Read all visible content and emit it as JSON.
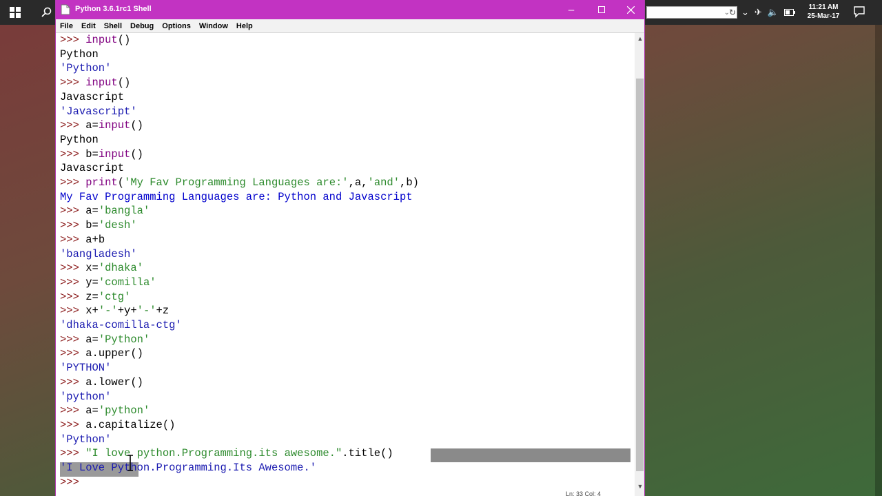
{
  "window": {
    "title": "Python 3.6.1rc1 Shell",
    "menu": [
      "File",
      "Edit",
      "Shell",
      "Debug",
      "Options",
      "Window",
      "Help"
    ]
  },
  "taskbar": {
    "time": "11:21 AM",
    "date": "25-Mar-17"
  },
  "status": {
    "text": "Ln: 33  Col: 4"
  },
  "shell_lines": [
    [
      {
        "t": ">>> ",
        "c": "prompt"
      },
      {
        "t": "input",
        "c": "kw"
      },
      {
        "t": "()",
        "c": "stdin"
      }
    ],
    [
      {
        "t": "Python",
        "c": "stdin"
      }
    ],
    [
      {
        "t": "'Python'",
        "c": "out"
      }
    ],
    [
      {
        "t": ">>> ",
        "c": "prompt"
      },
      {
        "t": "input",
        "c": "kw"
      },
      {
        "t": "()",
        "c": "stdin"
      }
    ],
    [
      {
        "t": "Javascript",
        "c": "stdin"
      }
    ],
    [
      {
        "t": "'Javascript'",
        "c": "out"
      }
    ],
    [
      {
        "t": ">>> ",
        "c": "prompt"
      },
      {
        "t": "a=",
        "c": "stdin"
      },
      {
        "t": "input",
        "c": "kw"
      },
      {
        "t": "()",
        "c": "stdin"
      }
    ],
    [
      {
        "t": "Python",
        "c": "stdin"
      }
    ],
    [
      {
        "t": ">>> ",
        "c": "prompt"
      },
      {
        "t": "b=",
        "c": "stdin"
      },
      {
        "t": "input",
        "c": "kw"
      },
      {
        "t": "()",
        "c": "stdin"
      }
    ],
    [
      {
        "t": "Javascript",
        "c": "stdin"
      }
    ],
    [
      {
        "t": ">>> ",
        "c": "prompt"
      },
      {
        "t": "print",
        "c": "kw"
      },
      {
        "t": "(",
        "c": "stdin"
      },
      {
        "t": "'My Fav Programming Languages are:'",
        "c": "str"
      },
      {
        "t": ",a,",
        "c": "stdin"
      },
      {
        "t": "'and'",
        "c": "str"
      },
      {
        "t": ",b)",
        "c": "stdin"
      }
    ],
    [
      {
        "t": "My Fav Programming Languages are: Python and Javascript",
        "c": "stdout"
      }
    ],
    [
      {
        "t": ">>> ",
        "c": "prompt"
      },
      {
        "t": "a=",
        "c": "stdin"
      },
      {
        "t": "'bangla'",
        "c": "str"
      }
    ],
    [
      {
        "t": ">>> ",
        "c": "prompt"
      },
      {
        "t": "b=",
        "c": "stdin"
      },
      {
        "t": "'desh'",
        "c": "str"
      }
    ],
    [
      {
        "t": ">>> ",
        "c": "prompt"
      },
      {
        "t": "a+b",
        "c": "stdin"
      }
    ],
    [
      {
        "t": "'bangladesh'",
        "c": "out"
      }
    ],
    [
      {
        "t": ">>> ",
        "c": "prompt"
      },
      {
        "t": "x=",
        "c": "stdin"
      },
      {
        "t": "'dhaka'",
        "c": "str"
      }
    ],
    [
      {
        "t": ">>> ",
        "c": "prompt"
      },
      {
        "t": "y=",
        "c": "stdin"
      },
      {
        "t": "'comilla'",
        "c": "str"
      }
    ],
    [
      {
        "t": ">>> ",
        "c": "prompt"
      },
      {
        "t": "z=",
        "c": "stdin"
      },
      {
        "t": "'ctg'",
        "c": "str"
      }
    ],
    [
      {
        "t": ">>> ",
        "c": "prompt"
      },
      {
        "t": "x+",
        "c": "stdin"
      },
      {
        "t": "'-'",
        "c": "str"
      },
      {
        "t": "+y+",
        "c": "stdin"
      },
      {
        "t": "'-'",
        "c": "str"
      },
      {
        "t": "+z",
        "c": "stdin"
      }
    ],
    [
      {
        "t": "'dhaka-comilla-ctg'",
        "c": "out"
      }
    ],
    [
      {
        "t": ">>> ",
        "c": "prompt"
      },
      {
        "t": "a=",
        "c": "stdin"
      },
      {
        "t": "'Python'",
        "c": "str"
      }
    ],
    [
      {
        "t": ">>> ",
        "c": "prompt"
      },
      {
        "t": "a.upper()",
        "c": "stdin"
      }
    ],
    [
      {
        "t": "'PYTHON'",
        "c": "out"
      }
    ],
    [
      {
        "t": ">>> ",
        "c": "prompt"
      },
      {
        "t": "a.lower()",
        "c": "stdin"
      }
    ],
    [
      {
        "t": "'python'",
        "c": "out"
      }
    ],
    [
      {
        "t": ">>> ",
        "c": "prompt"
      },
      {
        "t": "a=",
        "c": "stdin"
      },
      {
        "t": "'python'",
        "c": "str"
      }
    ],
    [
      {
        "t": ">>> ",
        "c": "prompt"
      },
      {
        "t": "a.capitalize()",
        "c": "stdin"
      }
    ],
    [
      {
        "t": "'Python'",
        "c": "out"
      }
    ],
    [
      {
        "t": ">>> ",
        "c": "prompt"
      },
      {
        "t": "\"I love python.Programming.its awesome.\"",
        "c": "str"
      },
      {
        "t": ".title()",
        "c": "stdin"
      }
    ],
    [
      {
        "t": "'I Love Python.Programming.Its Awesome.'",
        "c": "out"
      }
    ],
    [
      {
        "t": ">>> ",
        "c": "prompt"
      }
    ]
  ]
}
